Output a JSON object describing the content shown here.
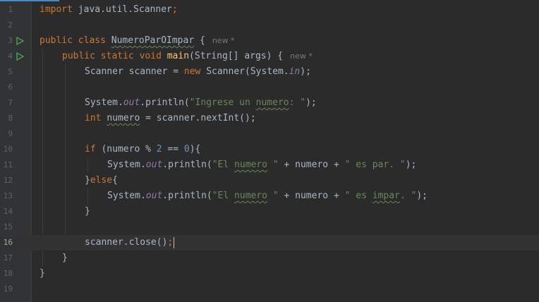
{
  "hint": "new *",
  "line_numbers": [
    "1",
    "2",
    "3",
    "4",
    "5",
    "6",
    "7",
    "8",
    "9",
    "10",
    "11",
    "12",
    "13",
    "14",
    "15",
    "16",
    "17",
    "18",
    "19"
  ],
  "code": {
    "l1": {
      "import": "import",
      "path": " java.util.Scanner",
      "semi": ";"
    },
    "l3": {
      "public": "public",
      "class": "class",
      "name": "NumeroParOImpar",
      "brace": " {"
    },
    "l4": {
      "public": "public",
      "static": "static",
      "void": "void",
      "name": "main",
      "params": "(String[] args) {"
    },
    "l5": {
      "decl": "Scanner scanner = ",
      "new": "new",
      "ctor": " Scanner(System.",
      "in": "in",
      "end": ");"
    },
    "l7": {
      "sys": "System.",
      "out": "out",
      "call": ".println(",
      "str_a": "\"Ingrese un ",
      "str_b": "numero",
      "str_c": ": \"",
      "end": ");"
    },
    "l8": {
      "int": "int",
      "var": "numero",
      "rest": " = scanner.nextInt();"
    },
    "l10": {
      "if": "if",
      "a": " (numero % ",
      "n2": "2",
      "b": " == ",
      "n0": "0",
      "c": "){"
    },
    "l11": {
      "sys": "System.",
      "out": "out",
      "call": ".println(",
      "str_a": "\"El ",
      "str_b": "numero",
      "str_c": " \"",
      "mid": " + numero + ",
      "str_d": "\" es par. \"",
      "end": ");"
    },
    "l12": {
      "a": "}",
      "else": "else",
      "b": "{"
    },
    "l13": {
      "sys": "System.",
      "out": "out",
      "call": ".println(",
      "str_a": "\"El ",
      "str_b": "numero",
      "str_c": " \"",
      "mid": " + numero + ",
      "str_d": "\" es ",
      "str_e": "impar",
      "str_f": ". \"",
      "end": ");"
    },
    "l14": {
      "text": "}"
    },
    "l16": {
      "text": "scanner.close()",
      "semi": ";"
    },
    "l17": {
      "text": "}"
    },
    "l18": {
      "text": "}"
    }
  }
}
